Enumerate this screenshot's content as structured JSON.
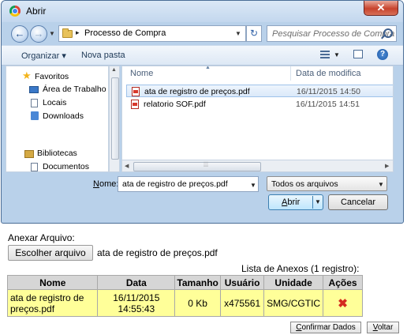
{
  "dialog": {
    "title": "Abrir",
    "close_glyph": "✕",
    "address": {
      "path": "Processo de Compra",
      "separator": "▸"
    },
    "search_placeholder": "Pesquisar Processo de Compra",
    "toolbar": {
      "organize": "Organizar ▾",
      "new_folder": "Nova pasta"
    },
    "nav": {
      "favorites": "Favoritos",
      "items": [
        "Área de Trabalho",
        "Locais",
        "Downloads"
      ],
      "libraries": "Bibliotecas",
      "library_items": [
        "Documentos"
      ]
    },
    "columns": {
      "name": "Nome",
      "date": "Data de modifica"
    },
    "files": [
      {
        "name": "ata de registro de preços.pdf",
        "date": "16/11/2015 14:50",
        "selected": true
      },
      {
        "name": "relatorio SOF.pdf",
        "date": "16/11/2015 14:51",
        "selected": false
      }
    ],
    "filename_label_u": "N",
    "filename_label_rest": "ome:",
    "filename_value": "ata de registro de preços.pdf",
    "filetype_value": "Todos os arquivos",
    "open_button_u": "A",
    "open_button_rest": "brir",
    "cancel_button": "Cancelar"
  },
  "page": {
    "attach_label": "Anexar Arquivo:",
    "choose_button": "Escolher arquivo",
    "chosen_file": "ata de registro de preços.pdf",
    "list_caption": "Lista de Anexos (1 registro):",
    "table": {
      "headers": [
        "Nome",
        "Data",
        "Tamanho",
        "Usuário",
        "Unidade",
        "Ações"
      ],
      "rows": [
        {
          "name": "ata de registro de preços.pdf",
          "date": "16/11/2015 14:55:43",
          "size": "0 Kb",
          "user": "x475561",
          "unit": "SMG/CGTIC",
          "action_glyph": "✖"
        }
      ]
    },
    "confirm_u": "C",
    "confirm_rest": "onfirmar Dados",
    "back_u": "V",
    "back_rest": "oltar"
  }
}
